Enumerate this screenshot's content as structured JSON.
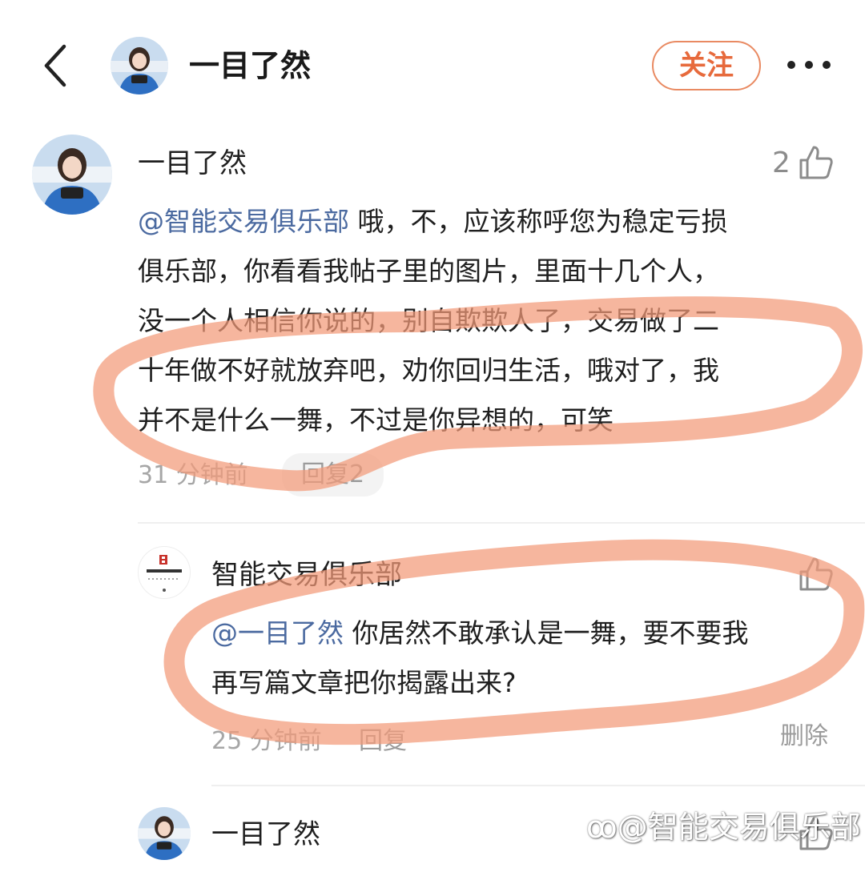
{
  "header": {
    "title": "一目了然",
    "follow_label": "关注"
  },
  "comments": [
    {
      "author": "一目了然",
      "likes": "2",
      "mention": "@智能交易俱乐部",
      "text_lines": [
        " 哦，不，应该称呼您为稳定亏损",
        "俱乐部，你看看我帖子里的图片，里面十几个人，",
        "没一个人相信你说的，别自欺欺人了，交易做了二",
        "十年做不好就放弃吧，劝你回归生活，哦对了，我",
        "并不是什么一舞，不过是你异想的，可笑"
      ],
      "time": "31 分钟前",
      "reply_label": "回复2"
    }
  ],
  "replies": [
    {
      "author": "智能交易俱乐部",
      "avatar_text": "金牌智能交易俱乐部",
      "mention": "@一目了然",
      "text_lines": [
        " 你居然不敢承认是一舞，要不要我",
        "再写篇文章把你揭露出来?"
      ],
      "time": "25 分钟前",
      "reply_label": "回复",
      "delete_label": "删除"
    },
    {
      "author": "一目了然"
    }
  ],
  "watermark": "@智能交易俱乐部",
  "colors": {
    "accent": "#e76a3c",
    "mention": "#4b6aa0",
    "annotation": "#f39a78"
  }
}
